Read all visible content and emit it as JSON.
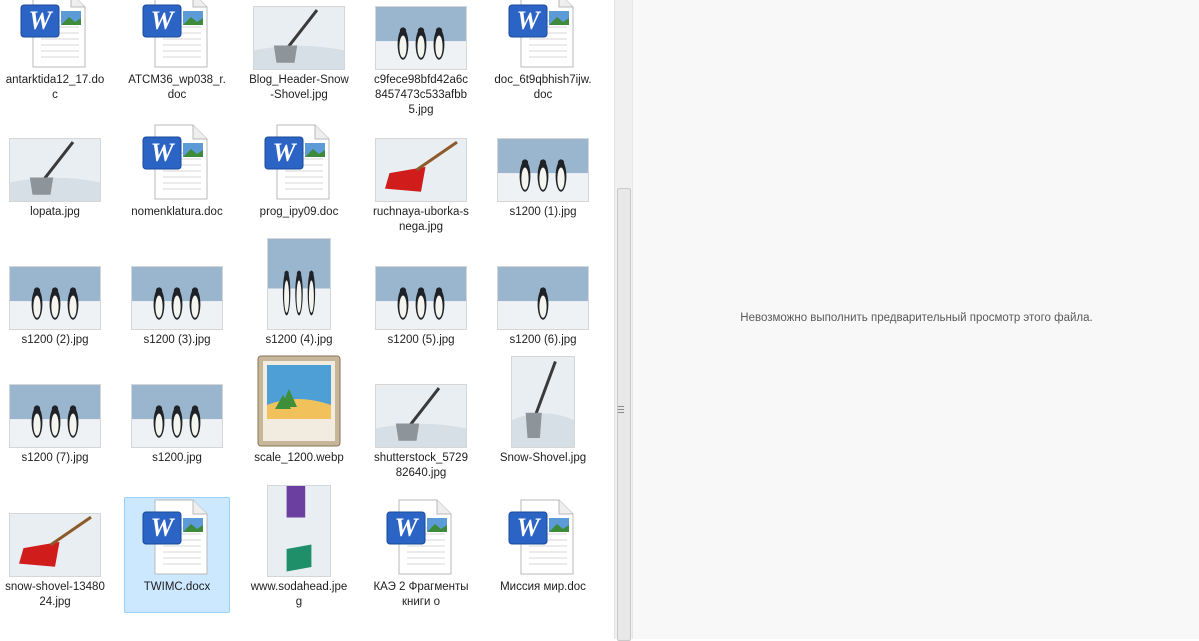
{
  "files": [
    {
      "name": "antarktida12_17.doc",
      "type": "doc"
    },
    {
      "name": "ATCM36_wp038_r.doc",
      "type": "doc"
    },
    {
      "name": "Blog_Header-Snow-Shovel.jpg",
      "type": "image",
      "icon": "snow-shovel-photo"
    },
    {
      "name": "c9fece98bfd42a6c8457473c533afbb5.jpg",
      "type": "image",
      "icon": "penguins-photo"
    },
    {
      "name": "doc_6t9qbhish7ijw.doc",
      "type": "doc"
    },
    {
      "name": "lopata.jpg",
      "type": "image",
      "icon": "shovel-in-snow-photo"
    },
    {
      "name": "nomenklatura.doc",
      "type": "doc"
    },
    {
      "name": "prog_ipy09.doc",
      "type": "doc"
    },
    {
      "name": "ruchnaya-uborka-snega.jpg",
      "type": "image",
      "icon": "red-shovels-photo"
    },
    {
      "name": "s1200 (1).jpg",
      "type": "image",
      "icon": "penguins-photo"
    },
    {
      "name": "s1200 (2).jpg",
      "type": "image",
      "icon": "penguins-photo"
    },
    {
      "name": "s1200 (3).jpg",
      "type": "image",
      "icon": "penguins-photo"
    },
    {
      "name": "s1200 (4).jpg",
      "type": "image",
      "icon": "penguins-photo"
    },
    {
      "name": "s1200 (5).jpg",
      "type": "image",
      "icon": "penguins-photo"
    },
    {
      "name": "s1200 (6).jpg",
      "type": "image",
      "icon": "penguin-photo"
    },
    {
      "name": "s1200 (7).jpg",
      "type": "image",
      "icon": "penguins-photo"
    },
    {
      "name": "s1200.jpg",
      "type": "image",
      "icon": "penguins-photo"
    },
    {
      "name": "scale_1200.webp",
      "type": "generic-image",
      "icon": "image-file-icon"
    },
    {
      "name": "shutterstock_572982640.jpg",
      "type": "image",
      "icon": "shovel-in-snow-photo"
    },
    {
      "name": "Snow-Shovel.jpg",
      "type": "image",
      "icon": "snow-shovel-photo"
    },
    {
      "name": "snow-shovel-1348024.jpg",
      "type": "image",
      "icon": "red-shovel-photo"
    },
    {
      "name": "TWIMC.docx",
      "type": "docx",
      "selected": true
    },
    {
      "name": "www.sodahead.jpeg",
      "type": "image",
      "icon": "person-shoveling-photo"
    },
    {
      "name": "КАЭ 2 Фрагменты книги о",
      "type": "doc"
    },
    {
      "name": "Миссия мир.doc",
      "type": "doc"
    }
  ],
  "preview": {
    "message": "Невозможно выполнить предварительный просмотр этого файла."
  },
  "colors": {
    "selection_bg": "#cce8ff",
    "selection_border": "#99d1ff",
    "word_blue": "#2b64c4"
  }
}
